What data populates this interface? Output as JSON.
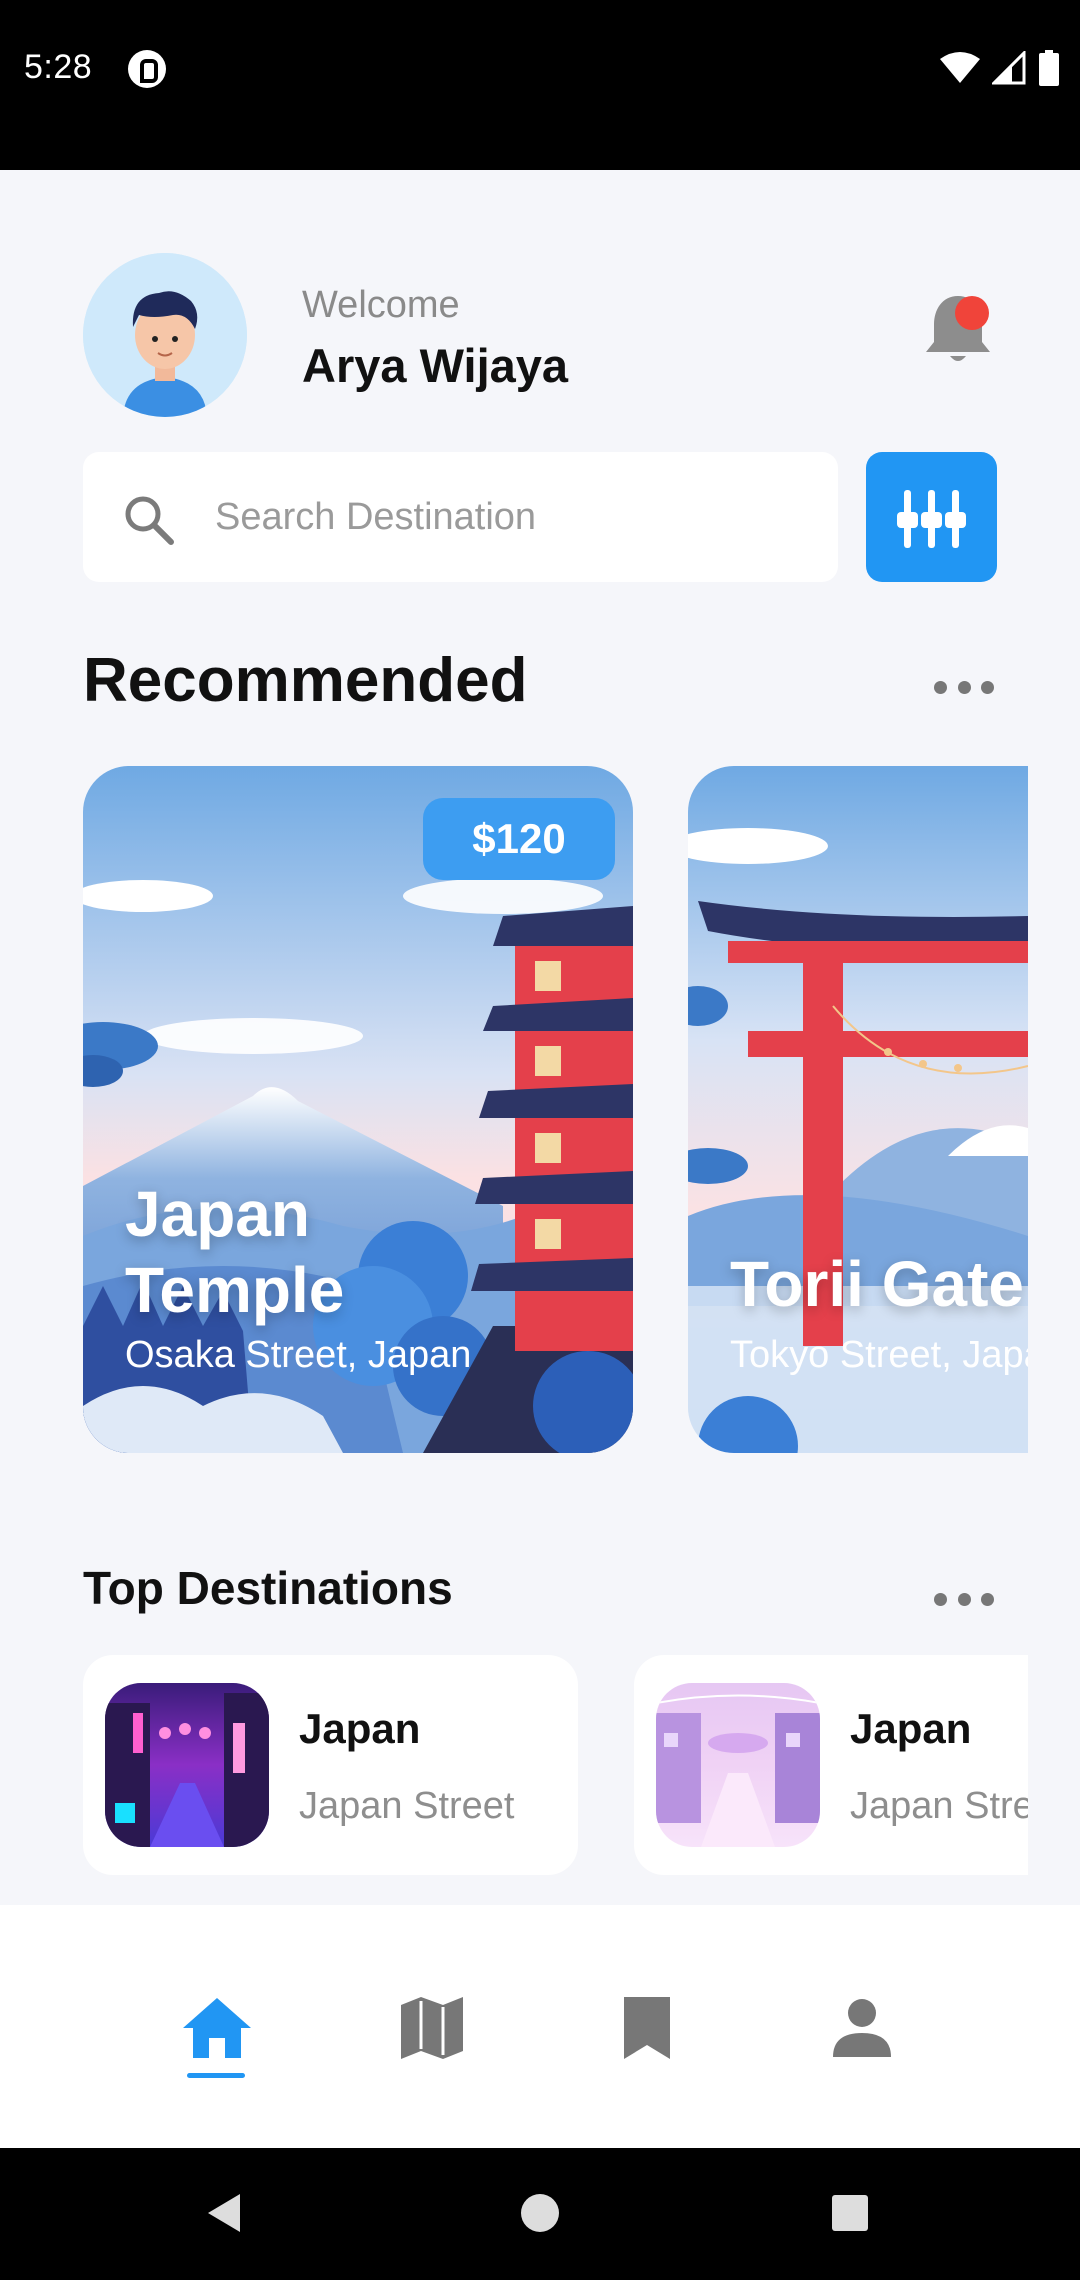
{
  "status_bar": {
    "time": "5:28"
  },
  "header": {
    "welcome": "Welcome",
    "user_name": "Arya Wijaya"
  },
  "search": {
    "placeholder": "Search Destination"
  },
  "recommended": {
    "title": "Recommended",
    "cards": [
      {
        "price": "$120",
        "title": "Japan Temple",
        "subtitle": "Osaka Street, Japan"
      },
      {
        "title": "Torii Gate",
        "subtitle": "Tokyo Street, Japan"
      }
    ]
  },
  "top_destinations": {
    "title": "Top Destinations",
    "items": [
      {
        "name": "Japan",
        "subtitle": "Japan Street"
      },
      {
        "name": "Japan",
        "subtitle": "Japan Street"
      }
    ]
  },
  "bottom_nav": {
    "items": [
      {
        "icon": "home-icon",
        "active": true
      },
      {
        "icon": "map-icon",
        "active": false
      },
      {
        "icon": "bookmark-icon",
        "active": false
      },
      {
        "icon": "person-icon",
        "active": false
      }
    ]
  },
  "colors": {
    "accent": "#2196f3",
    "notification": "#f0443a",
    "price_badge": "#3d9df1"
  }
}
